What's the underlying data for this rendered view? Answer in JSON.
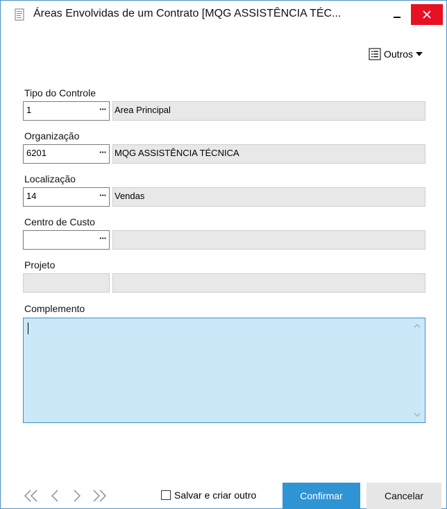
{
  "window": {
    "title": "Áreas Envolvidas de um Contrato [MQG ASSISTÊNCIA TÉC..."
  },
  "toolbar": {
    "outros_label": "Outros"
  },
  "fields": {
    "tipo_controle": {
      "label": "Tipo do Controle",
      "code": "1",
      "desc": "Area Principal"
    },
    "organizacao": {
      "label": "Organização",
      "code": "6201",
      "desc": "MQG ASSISTÊNCIA TÉCNICA"
    },
    "localizacao": {
      "label": "Localização",
      "code": "14",
      "desc": "Vendas"
    },
    "centro_custo": {
      "label": "Centro de Custo",
      "code": "",
      "desc": ""
    },
    "projeto": {
      "label": "Projeto",
      "code": "",
      "desc": ""
    },
    "complemento": {
      "label": "Complemento",
      "value": ""
    }
  },
  "lookup_glyph": "···",
  "footer": {
    "save_and_new": "Salvar e criar outro",
    "confirm": "Confirmar",
    "cancel": "Cancelar"
  },
  "colors": {
    "accent": "#2f94d3",
    "close": "#e81123",
    "textarea_bg": "#cbe8f8"
  }
}
